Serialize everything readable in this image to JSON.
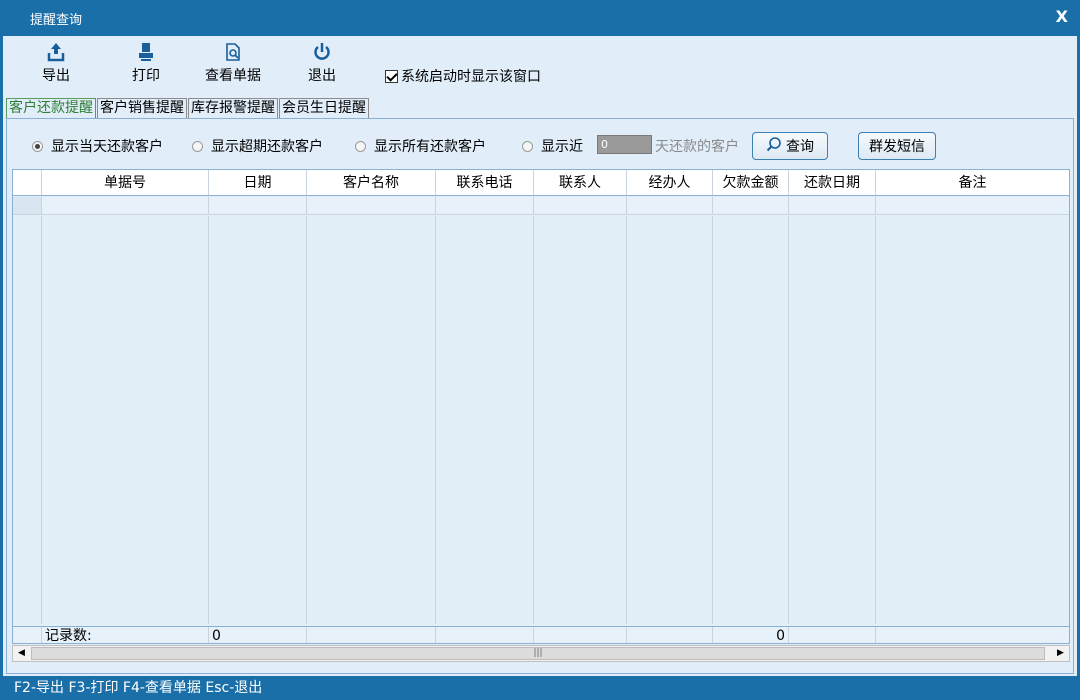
{
  "window": {
    "title": "提醒查询",
    "close_label": "X"
  },
  "toolbar": {
    "export_label": "导出",
    "print_label": "打印",
    "view_label": "查看单据",
    "exit_label": "退出",
    "show_on_start_label": "系统启动时显示该窗口",
    "show_on_start_checked": true
  },
  "tabs": [
    {
      "label": "客户还款提醒",
      "active": true
    },
    {
      "label": "客户销售提醒",
      "active": false
    },
    {
      "label": "库存报警提醒",
      "active": false
    },
    {
      "label": "会员生日提醒",
      "active": false
    }
  ],
  "filter": {
    "options": [
      {
        "label": "显示当天还款客户",
        "selected": true
      },
      {
        "label": "显示超期还款客户",
        "selected": false
      },
      {
        "label": "显示所有还款客户",
        "selected": false
      },
      {
        "label": "显示近",
        "selected": false
      }
    ],
    "days_value": "0",
    "days_suffix": "天还款的客户",
    "query_label": "查询",
    "sms_label": "群发短信"
  },
  "table": {
    "columns": [
      "单据号",
      "日期",
      "客户名称",
      "联系电话",
      "联系人",
      "经办人",
      "欠款金额",
      "还款日期",
      "备注"
    ],
    "footer": {
      "label": "记录数:",
      "count": "0",
      "amount_total": "0"
    }
  },
  "status_bar": {
    "text": "F2-导出 F3-打印 F4-查看单据 Esc-退出"
  },
  "colors": {
    "frame": "#1a6fa8",
    "client": "#e1eefa",
    "active_tab": "#2e7d32"
  }
}
